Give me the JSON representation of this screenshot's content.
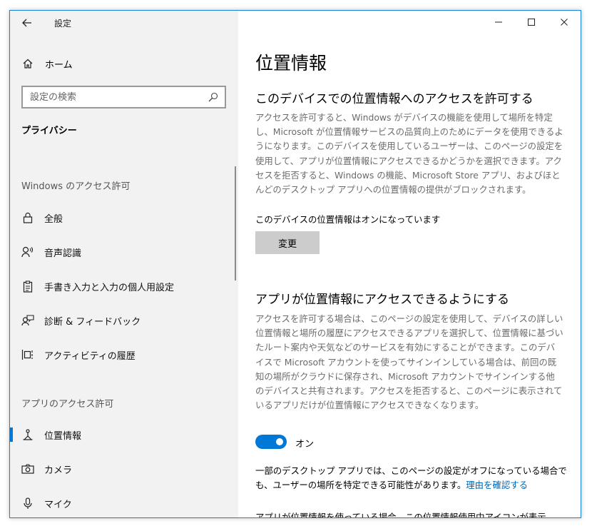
{
  "window": {
    "title": "設定",
    "controls": [
      "minimize-icon",
      "maximize-icon",
      "close-icon"
    ],
    "accent_color": "#0078d7"
  },
  "sidebar": {
    "home_label": "ホーム",
    "search_placeholder": "設定の検索",
    "section_title": "プライバシー",
    "windows_group_label": "Windows のアクセス許可",
    "windows_items": [
      {
        "label": "全般",
        "icon": "lock-icon"
      },
      {
        "label": "音声認識",
        "icon": "speech-icon"
      },
      {
        "label": "手書き入力と入力の個人用設定",
        "icon": "clipboard-icon"
      },
      {
        "label": "診断 & フィードバック",
        "icon": "feedback-icon"
      },
      {
        "label": "アクティビティの履歴",
        "icon": "timeline-icon"
      }
    ],
    "app_group_label": "アプリのアクセス許可",
    "app_items": [
      {
        "label": "位置情報",
        "icon": "location-icon",
        "active": true
      },
      {
        "label": "カメラ",
        "icon": "camera-icon"
      },
      {
        "label": "マイク",
        "icon": "microphone-icon"
      }
    ]
  },
  "main": {
    "page_title": "位置情報",
    "device_section": {
      "heading": "このデバイスでの位置情報へのアクセスを許可する",
      "description": "アクセスを許可すると、Windows がデバイスの機能を使用して場所を特定し、Microsoft が位置情報サービスの品質向上のためにデータを使用できるようになります。このデバイスを使用しているユーザーは、このページの設定を使用して、アプリが位置情報にアクセスできるかどうかを選択できます。アクセスを拒否すると、Windows の機能、Microsoft Store アプリ、およびほとんどのデスクトップ アプリへの位置情報の提供がブロックされます。",
      "status": "このデバイスの位置情報はオンになっています",
      "change_button": "変更"
    },
    "app_section": {
      "heading": "アプリが位置情報にアクセスできるようにする",
      "description": "アクセスを許可する場合は、このページの設定を使用して、デバイスの詳しい位置情報と場所の履歴にアクセスできるアプリを選択して、位置情報に基づいたルート案内や天気などのサービスを有効にすることができます。このデバイスで Microsoft アカウントを使ってサインインしている場合は、前回の既知の場所がクラウドに保存され、Microsoft アカウントでサインインする他のデバイスと共有されます。アクセスを拒否すると、このページに表示されているアプリだけが位置情報にアクセスできなくなります。",
      "toggle_state": "オン",
      "toggle_on": true,
      "note": "一部のデスクトップ アプリでは、このページの設定がオフになっている場合でも、ユーザーの場所を特定できる可能性があります。",
      "note_link": "理由を確認する",
      "cut_off_text": "アプリが位置情報を使っている場合、この位置情報使用中アイコンが表示"
    }
  }
}
